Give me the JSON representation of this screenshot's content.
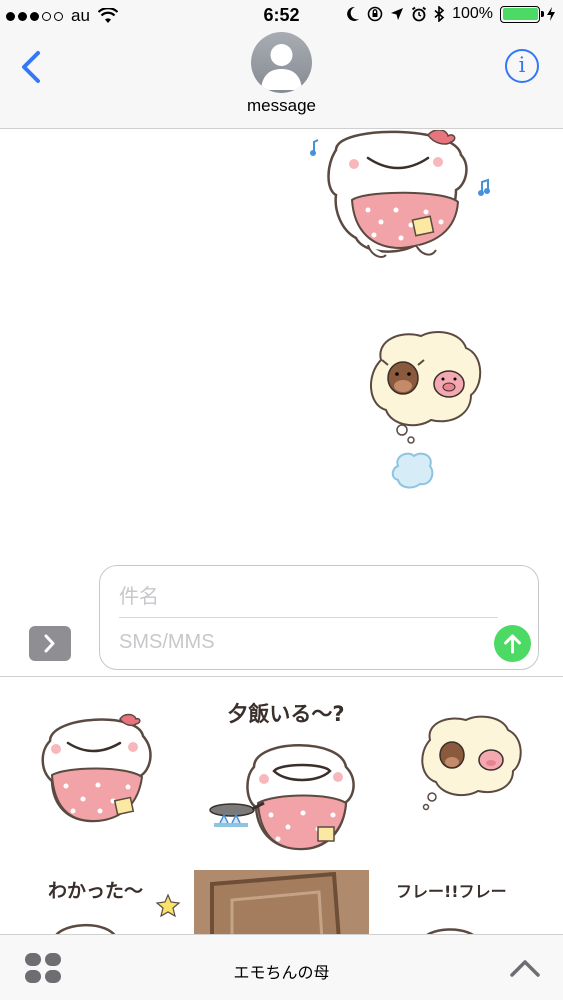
{
  "status_bar": {
    "carrier": "au",
    "time": "6:52",
    "battery_percent": "100%",
    "battery_level": 1.0,
    "battery_color": "#4cd964"
  },
  "nav": {
    "back_icon": "chevron-left-icon",
    "contact_name": "message",
    "info_icon_glyph": "i",
    "accent_color": "#3478f6"
  },
  "composer": {
    "subject_placeholder": "件名",
    "message_placeholder": "SMS/MMS",
    "send_color": "#4cd964"
  },
  "stickers": {
    "dinner_caption": "夕飯いる〜?",
    "understood_caption": "わかった〜",
    "cheer_caption": "フレー!!フレー"
  },
  "bottom_bar": {
    "sticker_pack_name": "エモちんの母"
  }
}
